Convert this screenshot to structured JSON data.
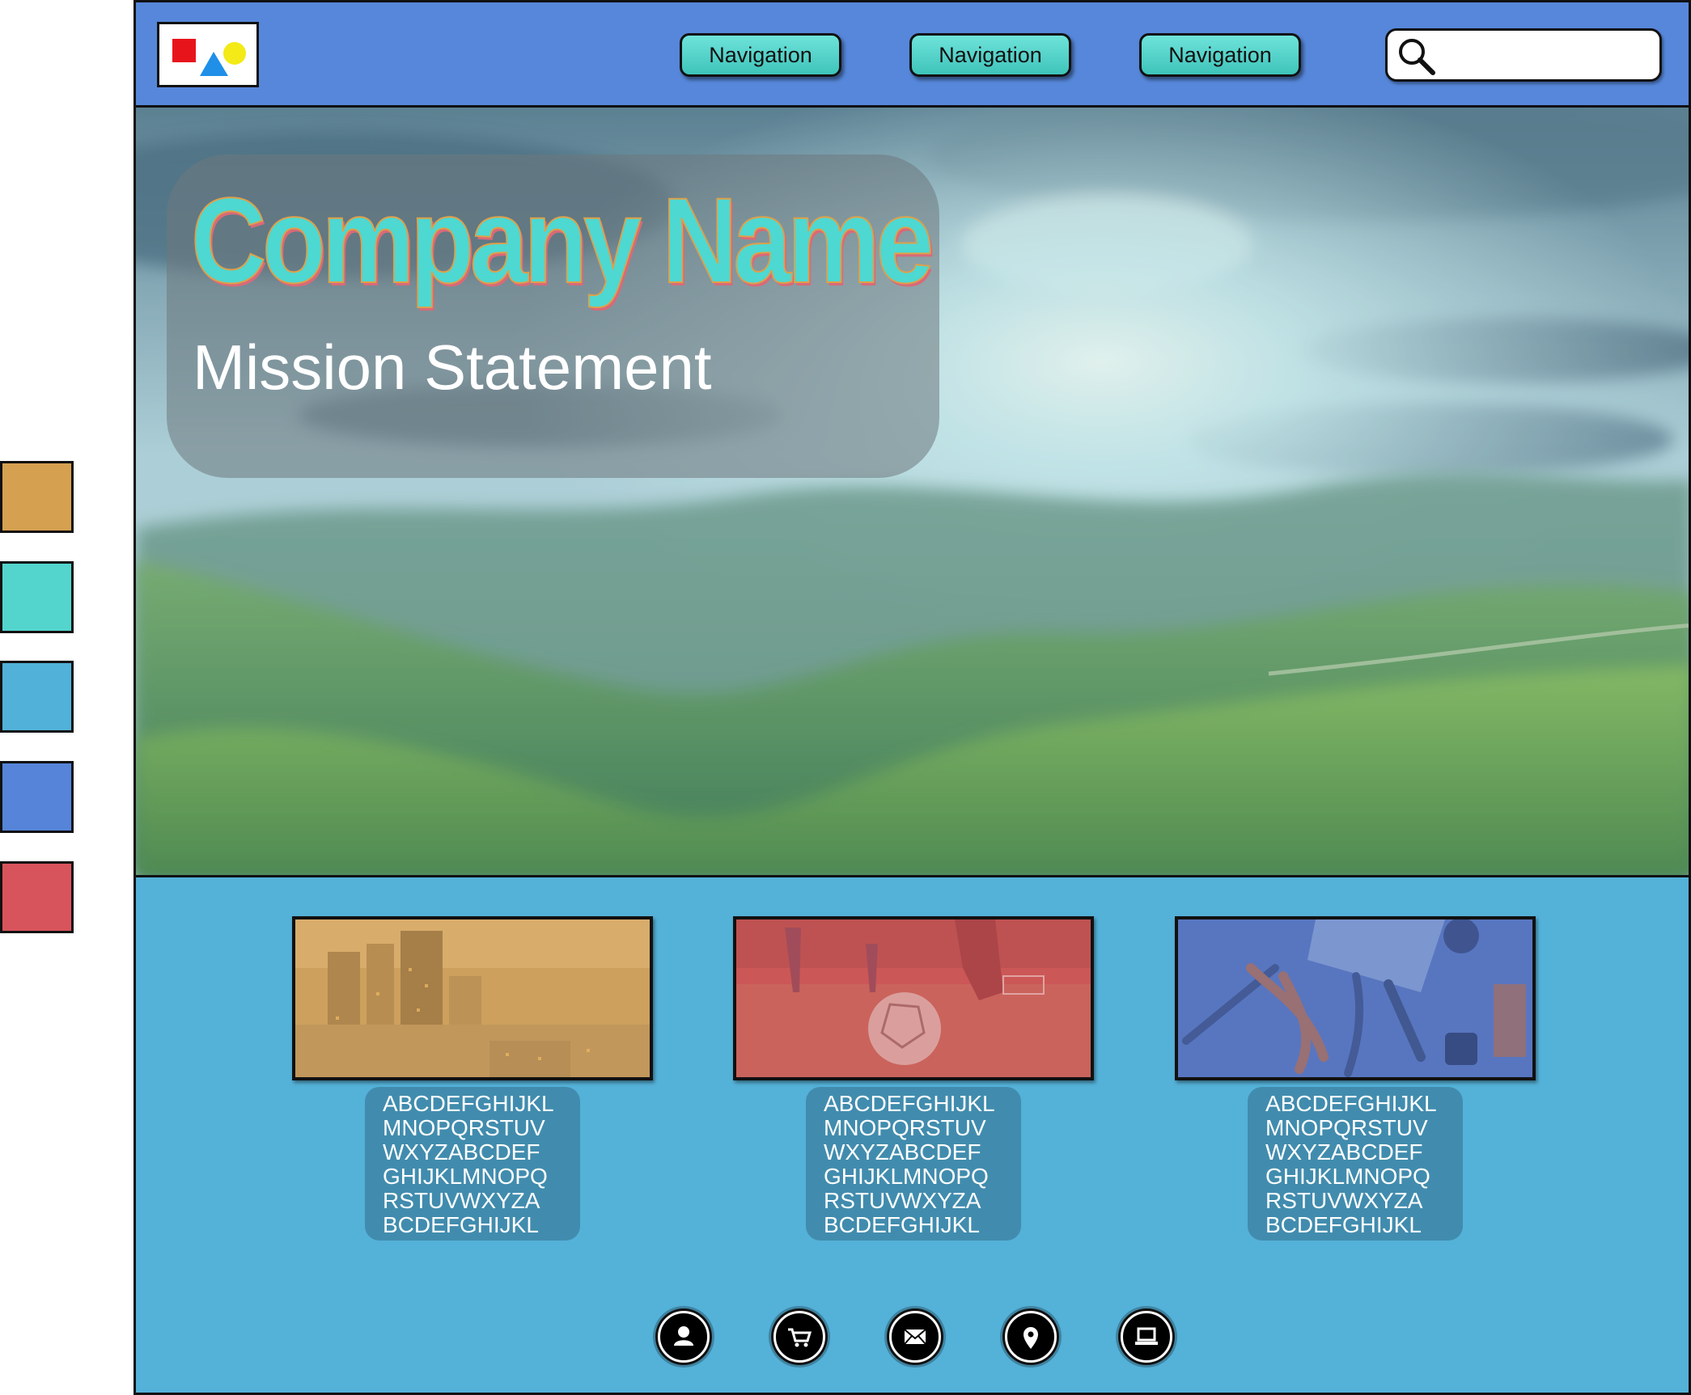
{
  "palette": {
    "colors": [
      "#d5a050",
      "#53d5cd",
      "#51b1d8",
      "#5584d9",
      "#d8545d"
    ]
  },
  "header": {
    "logo_icon": "shapes-logo-icon",
    "nav": [
      {
        "label": "Navigation"
      },
      {
        "label": "Navigation"
      },
      {
        "label": "Navigation"
      }
    ],
    "search": {
      "placeholder": "",
      "icon": "search-icon"
    }
  },
  "hero": {
    "background": "sunset-hills-image",
    "company_name": "Company Name",
    "mission": "Mission Statement"
  },
  "cards": [
    {
      "image": "city-skyline-image",
      "tint": "#d5a050",
      "lines": [
        "ABCDEFGHIJKL",
        "MNOPQRSTUV",
        "WXYZABCDEF",
        "GHIJKLMNOPQ",
        "RSTUVWXYZA",
        "BCDEFGHIJKL"
      ]
    },
    {
      "image": "soccer-image",
      "tint": "#d8545d",
      "lines": [
        "ABCDEFGHIJKL",
        "MNOPQRSTUV",
        "WXYZABCDEF",
        "GHIJKLMNOPQ",
        "RSTUVWXYZA",
        "BCDEFGHIJKL"
      ]
    },
    {
      "image": "tools-image",
      "tint": "#5584d9",
      "lines": [
        "ABCDEFGHIJKL",
        "MNOPQRSTUV",
        "WXYZABCDEF",
        "GHIJKLMNOPQ",
        "RSTUVWXYZA",
        "BCDEFGHIJKL"
      ]
    }
  ],
  "footer": {
    "icons": [
      "user-icon",
      "cart-icon",
      "mail-icon",
      "location-pin-icon",
      "laptop-icon"
    ]
  }
}
